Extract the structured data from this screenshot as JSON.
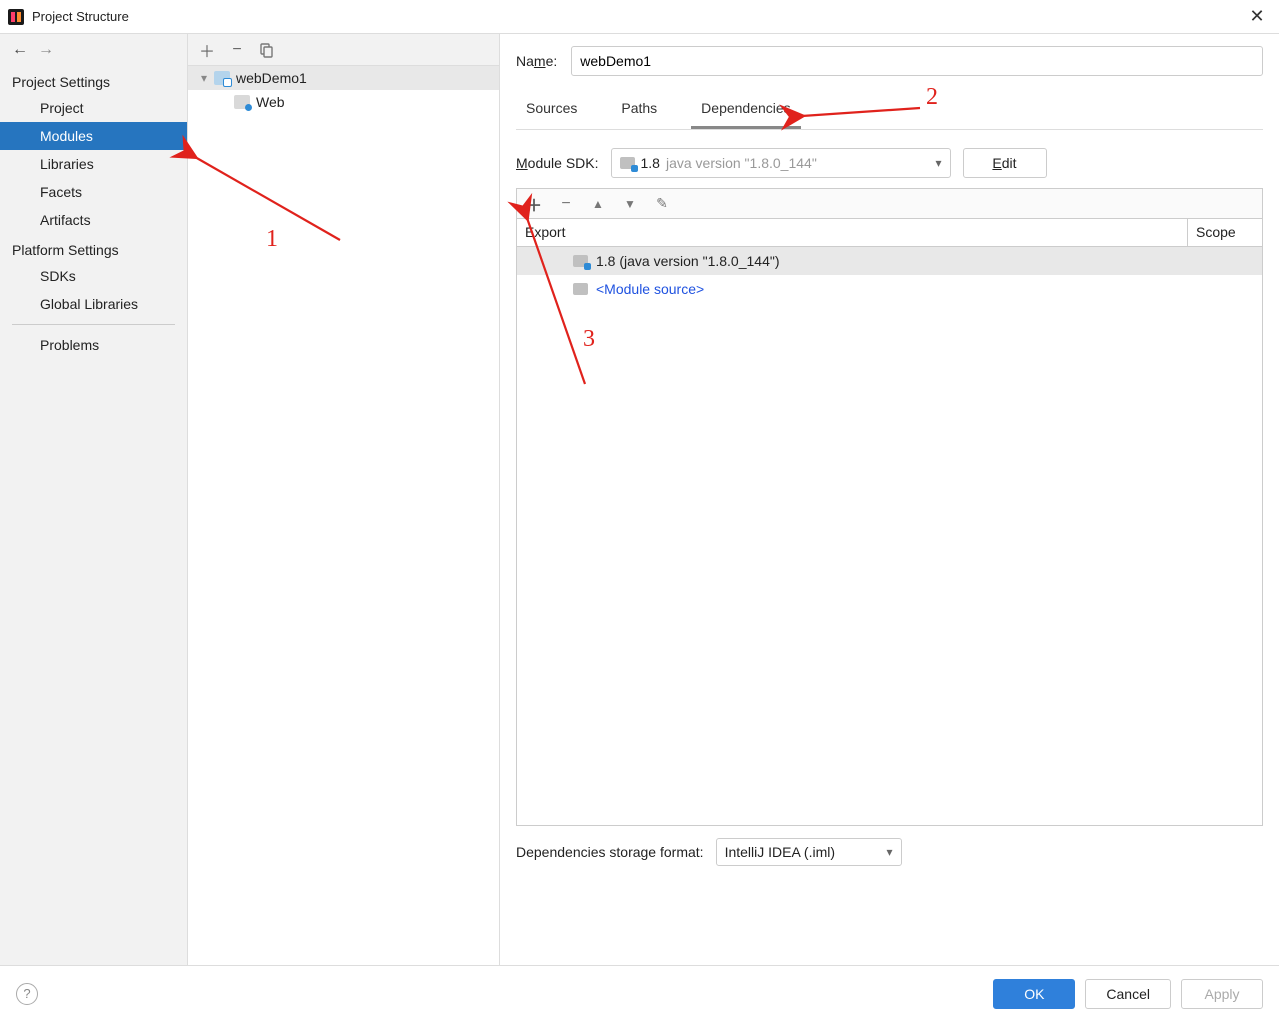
{
  "window": {
    "title": "Project Structure"
  },
  "leftNav": {
    "sections": [
      {
        "title": "Project Settings",
        "items": [
          "Project",
          "Modules",
          "Libraries",
          "Facets",
          "Artifacts"
        ],
        "selectedIndex": 1
      },
      {
        "title": "Platform Settings",
        "items": [
          "SDKs",
          "Global Libraries"
        ]
      }
    ],
    "problems": "Problems"
  },
  "tree": {
    "root": {
      "label": "webDemo1",
      "children": [
        {
          "label": "Web"
        }
      ]
    }
  },
  "content": {
    "nameLabel_pre": "Na",
    "nameLabel_u": "m",
    "nameLabel_post": "e:",
    "nameValue": "webDemo1",
    "tabs": [
      "Sources",
      "Paths",
      "Dependencies"
    ],
    "activeTab": 2,
    "sdkLabel_u": "M",
    "sdkLabel_post": "odule SDK:",
    "sdk": {
      "version": "1.8",
      "sub": "java version \"1.8.0_144\""
    },
    "editLabel_u": "E",
    "editLabel_post": "dit",
    "depTable": {
      "headerExport": "Export",
      "headerScope": "Scope",
      "rows": [
        {
          "type": "sdk",
          "label": "1.8 (java version \"1.8.0_144\")"
        },
        {
          "type": "source",
          "label": "<Module source>"
        }
      ]
    },
    "storageLabel": "Dependencies storage format:",
    "storageValue": "IntelliJ IDEA (.iml)"
  },
  "footer": {
    "ok": "OK",
    "cancel": "Cancel",
    "apply": "Apply"
  },
  "annotations": {
    "n1": "1",
    "n2": "2",
    "n3": "3"
  }
}
